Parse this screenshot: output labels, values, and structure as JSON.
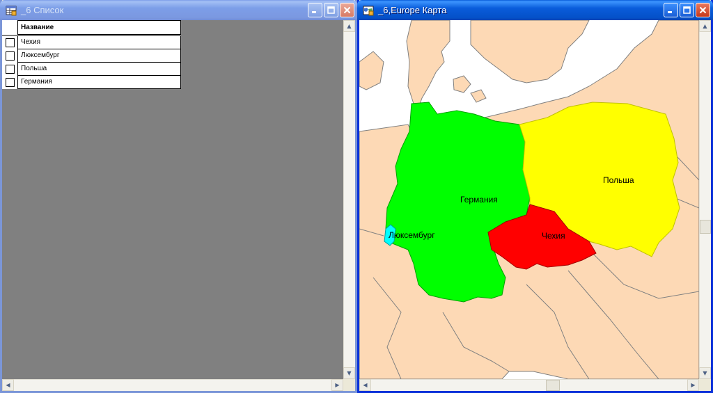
{
  "list_window": {
    "title": "_6 Список",
    "column_header": "Название",
    "rows": [
      {
        "name": "Чехия"
      },
      {
        "name": "Люксембург"
      },
      {
        "name": "Польша"
      },
      {
        "name": "Германия"
      }
    ]
  },
  "map_window": {
    "title": "_6,Europe Карта",
    "labels": {
      "germany": "Германия",
      "poland": "Польша",
      "czech": "Чехия",
      "luxembourg": "Люксембург"
    },
    "colors": {
      "germany": "#00ff00",
      "poland": "#ffff00",
      "czech": "#ff0000",
      "luxembourg": "#00ffff",
      "land": "#fdd9b5",
      "sea": "#ffffff",
      "border": "#808080"
    }
  },
  "icons": [
    "table-icon",
    "map-icon",
    "minimize-icon",
    "maximize-icon",
    "close-icon"
  ]
}
